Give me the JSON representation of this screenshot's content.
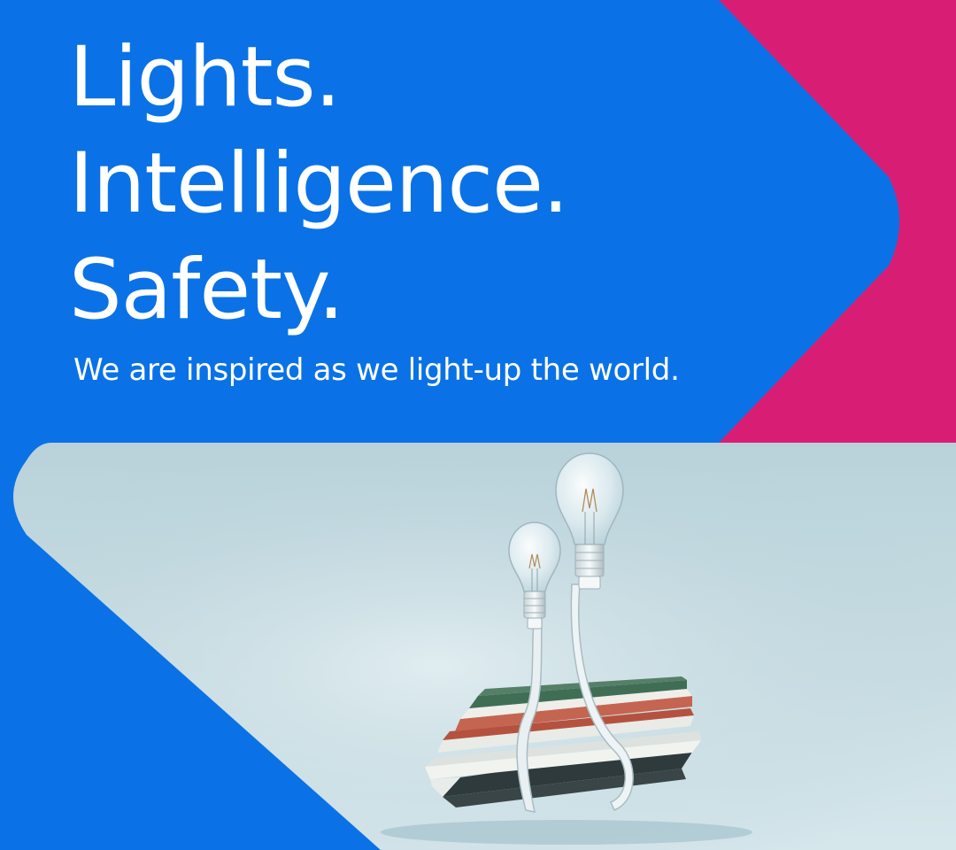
{
  "headline": {
    "line1": "Lights.",
    "line2": "Intelligence.",
    "line3": "Safety."
  },
  "tagline": "We are inspired as we light-up the world.",
  "colors": {
    "brand_blue": "#0a72e6",
    "accent_pink": "#d81e74",
    "text": "#ffffff"
  },
  "illustration": {
    "subject": "books-with-light-bulbs-illustration",
    "icons": [
      "light-bulb-icon",
      "light-bulb-icon",
      "book-stack-icon"
    ]
  }
}
